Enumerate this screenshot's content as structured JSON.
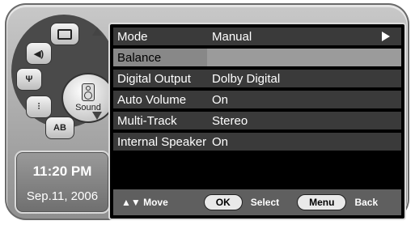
{
  "wheel": {
    "center_label": "Sound",
    "segments": [
      "",
      "",
      "",
      "",
      "AB"
    ]
  },
  "clock": {
    "time": "11:20 PM",
    "date": "Sep.11, 2006"
  },
  "menu": {
    "rows": [
      {
        "key": "Mode",
        "value": "Manual"
      },
      {
        "key": "Balance",
        "value": ""
      },
      {
        "key": "Digital Output",
        "value": "Dolby Digital"
      },
      {
        "key": "Auto Volume",
        "value": "On"
      },
      {
        "key": "Multi-Track",
        "value": "Stereo"
      },
      {
        "key": "Internal Speaker",
        "value": "On"
      }
    ]
  },
  "footer": {
    "move_label": "▲▼ Move",
    "ok_button": "OK",
    "select_label": "Select",
    "menu_button": "Menu",
    "back_label": "Back"
  }
}
